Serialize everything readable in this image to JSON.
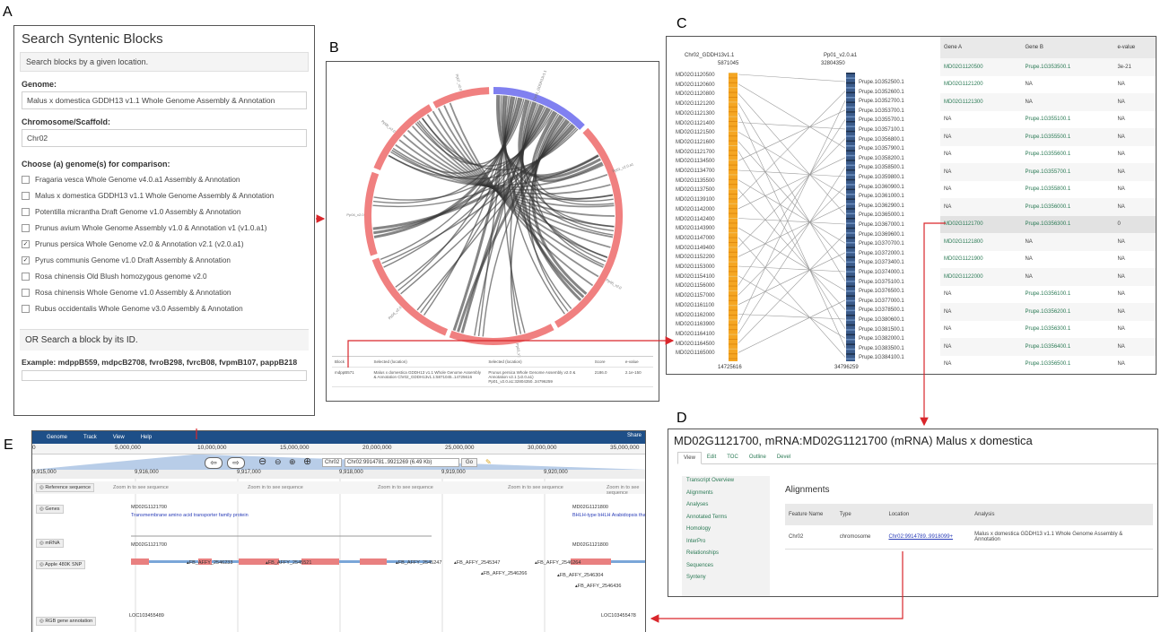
{
  "labels": {
    "a": "A",
    "b": "B",
    "c": "C",
    "d": "D",
    "e": "E"
  },
  "panel_a": {
    "title": "Search Syntenic Blocks",
    "hint": "Search blocks by a given location.",
    "genome_label": "Genome:",
    "genome_value": "Malus x domestica GDDH13 v1.1 Whole Genome Assembly & Annotation",
    "chr_label": "Chromosome/Scaffold:",
    "chr_value": "Chr02",
    "compare_label": "Choose (a) genome(s) for comparison:",
    "genomes": [
      {
        "label": "Fragaria vesca Whole Genome v4.0.a1 Assembly & Annotation",
        "checked": false
      },
      {
        "label": "Malus x domestica GDDH13 v1.1 Whole Genome Assembly & Annotation",
        "checked": false
      },
      {
        "label": "Potentilla micrantha Draft Genome v1.0 Assembly & Annotation",
        "checked": false
      },
      {
        "label": "Prunus avium Whole Genome Assembly v1.0 & Annotation v1 (v1.0.a1)",
        "checked": false
      },
      {
        "label": "Prunus persica Whole Genome v2.0 & Annotation v2.1 (v2.0.a1)",
        "checked": true
      },
      {
        "label": "Pyrus communis Genome v1.0 Draft Assembly & Annotation",
        "checked": true
      },
      {
        "label": "Rosa chinensis Old Blush homozygous genome v2.0",
        "checked": false
      },
      {
        "label": "Rosa chinensis Whole Genome v1.0 Assembly & Annotation",
        "checked": false
      },
      {
        "label": "Rubus occidentalis Whole Genome v3.0 Assembly & Annotation",
        "checked": false
      }
    ],
    "or_label": "OR Search a block by its ID.",
    "example": "Example: mdppB559, mdpcB2708, fvroB298, fvrcB08, fvpmB107, pappB218"
  },
  "panel_b": {
    "chromosomes": [
      "Chr02_GDDH13v1.1",
      "Pp01_v2.0.a1",
      "Pp03_v2.0",
      "Pp06_v2.0",
      "Pp04_v2.0",
      "Pp08_v2.0",
      "Pp07_v2.0",
      "Pp05_v2.0"
    ],
    "table_headers": [
      "Block",
      "Selected (location)",
      "Selected (location)",
      "Score",
      "e-value"
    ],
    "table_row": [
      "mdppB571",
      "Malus x domestica GDDH13 v1.1 Whole Genome Assembly & Annotation Chr02_GDDH13v1.1:5871045..14725616",
      "Prunus persica Whole Genome Assembly v2.0 & Annotation v2.1 (v2.0.a1) Pp01_v2.0.a1:32804350..34796259",
      "2186.0",
      "2.1e-150"
    ]
  },
  "panel_c": {
    "chr_a": "Chr02_GDDH13v1.1",
    "chr_a_start": "5871045",
    "chr_a_end": "14725616",
    "chr_b": "Pp01_v2.0.a1",
    "chr_b_start": "32804350",
    "chr_b_end": "34796259",
    "genes_a": [
      "MD02G1120500",
      "MD02G1120600",
      "MD02G1120800",
      "MD02G1121200",
      "MD02G1121300",
      "MD02G1121400",
      "MD02G1121500",
      "MD02G1121600",
      "MD02G1121700",
      "MD02G1134500",
      "MD02G1134700",
      "MD02G1135500",
      "MD02G1137500",
      "MD02G1139100",
      "MD02G1142000",
      "MD02G1142400",
      "MD02G1143900",
      "MD02G1147000",
      "MD02G1149400",
      "MD02G1152200",
      "MD02G1153000",
      "MD02G1154100",
      "MD02G1156000",
      "MD02G1157000",
      "MD02G1161100",
      "MD02G1162000",
      "MD02G1163900",
      "MD02G1164100",
      "MD02G1164500",
      "MD02G1165000"
    ],
    "genes_b": [
      "Prupe.1G352500.1",
      "Prupe.1G352600.1",
      "Prupe.1G352700.1",
      "Prupe.1G353700.1",
      "Prupe.1G355700.1",
      "Prupe.1G357100.1",
      "Prupe.1G356800.1",
      "Prupe.1G357900.1",
      "Prupe.1G358200.1",
      "Prupe.1G358500.1",
      "Prupe.1G359800.1",
      "Prupe.1G360900.1",
      "Prupe.1G361000.1",
      "Prupe.1G362900.1",
      "Prupe.1G365000.1",
      "Prupe.1G367000.1",
      "Prupe.1G369600.1",
      "Prupe.1G370700.1",
      "Prupe.1G372000.1",
      "Prupe.1G373400.1",
      "Prupe.1G374000.1",
      "Prupe.1G375100.1",
      "Prupe.1G376500.1",
      "Prupe.1G377000.1",
      "Prupe.1G378500.1",
      "Prupe.1G380600.1",
      "Prupe.1G381500.1",
      "Prupe.1G382000.1",
      "Prupe.1G383500.1",
      "Prupe.1G384100.1"
    ],
    "table": {
      "headers": [
        "Gene A",
        "Gene B",
        "e-value"
      ],
      "rows": [
        [
          "MD02G1120500",
          "Prupe.1G353500.1",
          "3e-21"
        ],
        [
          "MD02G1121200",
          "NA",
          "NA"
        ],
        [
          "MD02G1121300",
          "NA",
          "NA"
        ],
        [
          "NA",
          "Prupe.1G355100.1",
          "NA"
        ],
        [
          "NA",
          "Prupe.1G355500.1",
          "NA"
        ],
        [
          "NA",
          "Prupe.1G355600.1",
          "NA"
        ],
        [
          "NA",
          "Prupe.1G355700.1",
          "NA"
        ],
        [
          "NA",
          "Prupe.1G355800.1",
          "NA"
        ],
        [
          "NA",
          "Prupe.1G356000.1",
          "NA"
        ],
        [
          "MD02G1121700",
          "Prupe.1G356300.1",
          "0"
        ],
        [
          "MD02G1121800",
          "NA",
          "NA"
        ],
        [
          "MD02G1121900",
          "NA",
          "NA"
        ],
        [
          "MD02G1122000",
          "NA",
          "NA"
        ],
        [
          "NA",
          "Prupe.1G356100.1",
          "NA"
        ],
        [
          "NA",
          "Prupe.1G356200.1",
          "NA"
        ],
        [
          "NA",
          "Prupe.1G356300.1",
          "NA"
        ],
        [
          "NA",
          "Prupe.1G356400.1",
          "NA"
        ],
        [
          "NA",
          "Prupe.1G356500.1",
          "NA"
        ]
      ]
    }
  },
  "panel_d": {
    "title": "MD02G1121700, mRNA:MD02G1121700 (mRNA) Malus x domestica",
    "tabs": [
      "View",
      "Edit",
      "TOC",
      "Outline",
      "Devel"
    ],
    "sidebar": [
      "Transcript Overview",
      "Alignments",
      "Analyses",
      "Annotated Terms",
      "Homology",
      "InterPro",
      "Relationships",
      "Sequences",
      "Synteny"
    ],
    "section": "Alignments",
    "headers": [
      "Feature Name",
      "Type",
      "Location",
      "Analysis"
    ],
    "row": [
      "Chr02",
      "chromosome",
      "Chr02:9914789..9918099+",
      "Malus x domestica GDDH13 v1.1 Whole Genome Assembly & Annotation"
    ]
  },
  "panel_e": {
    "menu": [
      "Genome",
      "Track",
      "View",
      "Help"
    ],
    "share": "Share",
    "ruler": [
      "0",
      "5,000,000",
      "10,000,000",
      "15,000,000",
      "20,000,000",
      "25,000,000",
      "30,000,000",
      "35,000,000"
    ],
    "sub_ruler": [
      "9,915,000",
      "9,916,000",
      "9,917,000",
      "9,918,000",
      "9,919,000",
      "9,920,000",
      "9,921,000"
    ],
    "location": "Chr02:9914781..9921269 (6.49 Kb)",
    "chr_select": "Chr02",
    "go": "Go",
    "zoom_text": "Zoom in to see sequence",
    "tracks": [
      "Reference sequence",
      "Genes",
      "mRNA",
      "Apple 480K SNP",
      "RGB gene annotation"
    ],
    "genes": [
      "MD02G1121700",
      "MD02G1121800"
    ],
    "gene_desc": [
      "Transmembrane amino acid transporter family protein",
      "BHLH-type bHLH Arabidopsis thaliana"
    ],
    "snps": [
      "FB_AFFY_2546233",
      "FB_AFFY_2545521",
      "FB_AFFY_2545247",
      "FB_AFFY_2545347",
      "FB_AFFY_2546264",
      "FB_AFFY_2546266",
      "FB_AFFY_2546304",
      "FB_AFFY_2546436"
    ],
    "rgb": [
      "LOC103455489",
      "LOC103455478"
    ]
  },
  "colors": {
    "arrow": "#d9262b",
    "chr_pink": "#f08080",
    "chr_blue": "#8080f0",
    "link_green": "#2b7a55",
    "menu_blue": "#1e4f88"
  }
}
